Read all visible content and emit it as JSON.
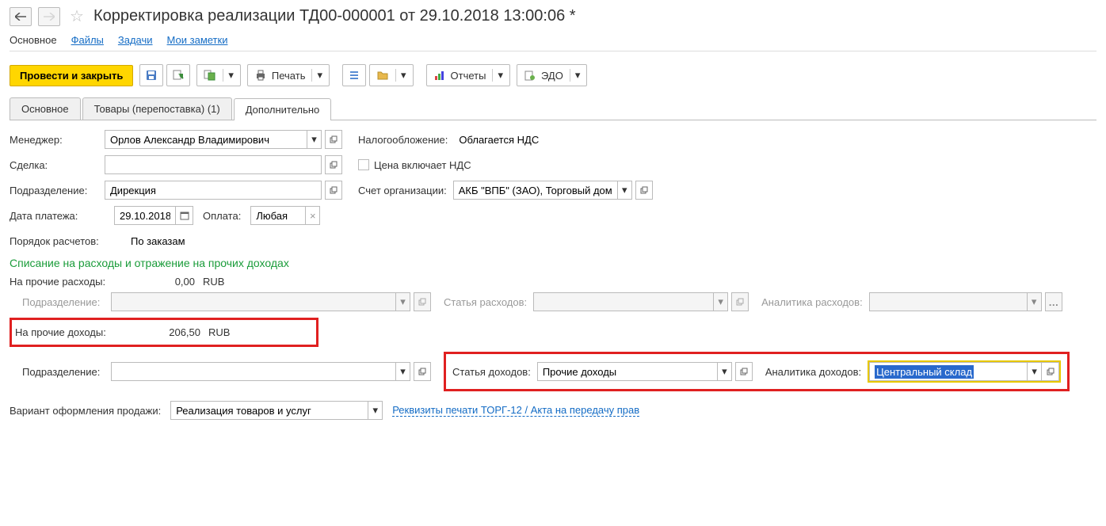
{
  "header": {
    "title": "Корректировка реализации ТД00-000001 от 29.10.2018 13:00:06 *"
  },
  "nav": {
    "main": "Основное",
    "files": "Файлы",
    "tasks": "Задачи",
    "notes": "Мои заметки"
  },
  "toolbar": {
    "submit_close": "Провести и закрыть",
    "print": "Печать",
    "reports": "Отчеты",
    "edo": "ЭДО"
  },
  "tabs": {
    "main": "Основное",
    "goods": "Товары (перепоставка) (1)",
    "additional": "Дополнительно"
  },
  "fields": {
    "manager_label": "Менеджер:",
    "manager_value": "Орлов Александр Владимирович",
    "deal_label": "Сделка:",
    "deal_value": "",
    "division_label": "Подразделение:",
    "division_value": "Дирекция",
    "payment_date_label": "Дата платежа:",
    "payment_date_value": "29.10.2018",
    "payment_label": "Оплата:",
    "payment_value": "Любая",
    "settlement_label": "Порядок расчетов:",
    "settlement_value": "По заказам",
    "tax_label": "Налогообложение:",
    "tax_value": "Облагается НДС",
    "vat_included": "Цена включает НДС",
    "account_label": "Счет организации:",
    "account_value": "АКБ \"ВПБ\" (ЗАО), Торговый дом \"К"
  },
  "section": {
    "title": "Списание на расходы и отражение на прочих доходах",
    "expenses_label": "На прочие расходы:",
    "expenses_value": "0,00",
    "expenses_cur": "RUB",
    "income_label": "На прочие доходы:",
    "income_value": "206,50",
    "income_cur": "RUB",
    "subdivision_label": "Подразделение:",
    "expense_item_label": "Статья расходов:",
    "expense_analytics_label": "Аналитика расходов:",
    "income_item_label": "Статья доходов:",
    "income_item_value": "Прочие доходы",
    "income_analytics_label": "Аналитика доходов:",
    "income_analytics_value": "Центральный склад"
  },
  "bottom": {
    "sale_variant_label": "Вариант оформления продажи:",
    "sale_variant_value": "Реализация товаров и услуг",
    "torg_link": "Реквизиты печати ТОРГ-12 / Акта на передачу прав"
  }
}
